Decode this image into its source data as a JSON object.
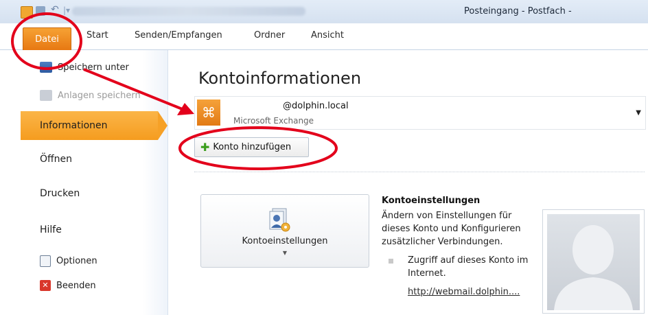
{
  "window": {
    "title": "Posteingang - Postfach -"
  },
  "ribbon": {
    "tabs": {
      "datei": "Datei",
      "start": "Start",
      "senden": "Senden/Empfangen",
      "ordner": "Ordner",
      "ansicht": "Ansicht"
    }
  },
  "backstage": {
    "commands": {
      "save_as": "Speichern unter",
      "save_attachments": "Anlagen speichern"
    },
    "nav": {
      "info": "Informationen",
      "open": "Öffnen",
      "print": "Drucken",
      "help": "Hilfe",
      "options": "Optionen",
      "exit": "Beenden"
    }
  },
  "main": {
    "title": "Kontoinformationen",
    "account": {
      "email": "@dolphin.local",
      "type": "Microsoft Exchange"
    },
    "add_account_label": "Konto hinzufügen",
    "settings_button_label": "Kontoeinstellungen",
    "info": {
      "heading": "Kontoeinstellungen",
      "description": "Ändern von Einstellungen für dieses Konto und Konfigurieren zusätzlicher Verbindungen.",
      "bullet": "Zugriff auf dieses Konto im Internet.",
      "link": "http://webmail.dolphin...."
    }
  },
  "colors": {
    "accent_orange": "#f59c1f",
    "annotation_red": "#e3001b"
  }
}
